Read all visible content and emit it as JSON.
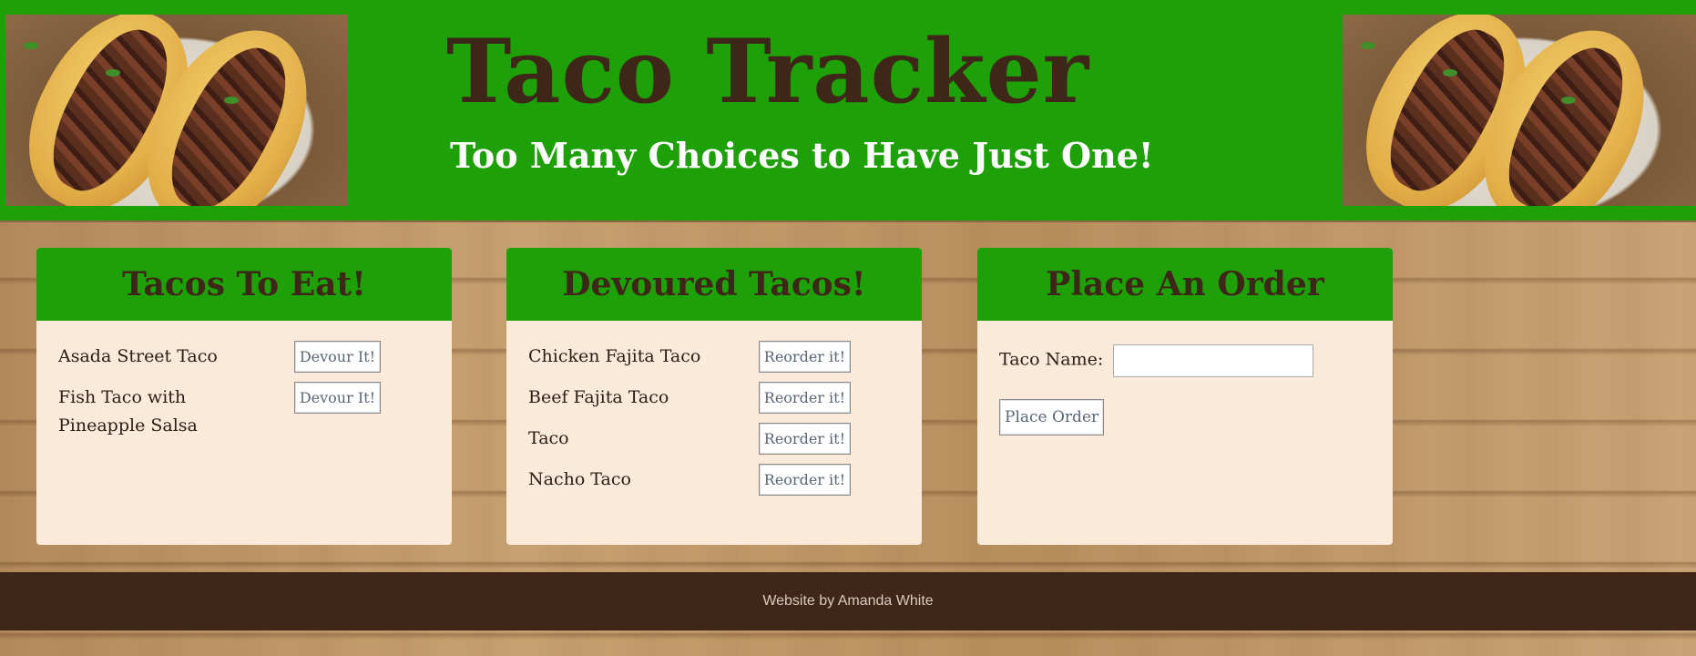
{
  "header": {
    "title": "Taco Tracker",
    "subtitle": "Too Many Choices to Have Just One!"
  },
  "to_eat": {
    "heading": "Tacos To Eat!",
    "items": [
      {
        "name": "Asada Street Taco",
        "button": "Devour It!"
      },
      {
        "name": "Fish Taco with Pineapple Salsa",
        "button": "Devour It!"
      }
    ]
  },
  "devoured": {
    "heading": "Devoured Tacos!",
    "items": [
      {
        "name": "Chicken Fajita Taco",
        "button": "Reorder it!"
      },
      {
        "name": "Beef Fajita Taco",
        "button": "Reorder it!"
      },
      {
        "name": "Taco",
        "button": "Reorder it!"
      },
      {
        "name": "Nacho Taco",
        "button": "Reorder it!"
      }
    ]
  },
  "order": {
    "heading": "Place An Order",
    "label": "Taco Name:",
    "value": "",
    "button": "Place Order"
  },
  "footer": {
    "credit": "Website by Amanda White"
  },
  "colors": {
    "header_green": "#1ea009",
    "brown": "#3e2718",
    "panel_bg": "#fbe9da"
  }
}
